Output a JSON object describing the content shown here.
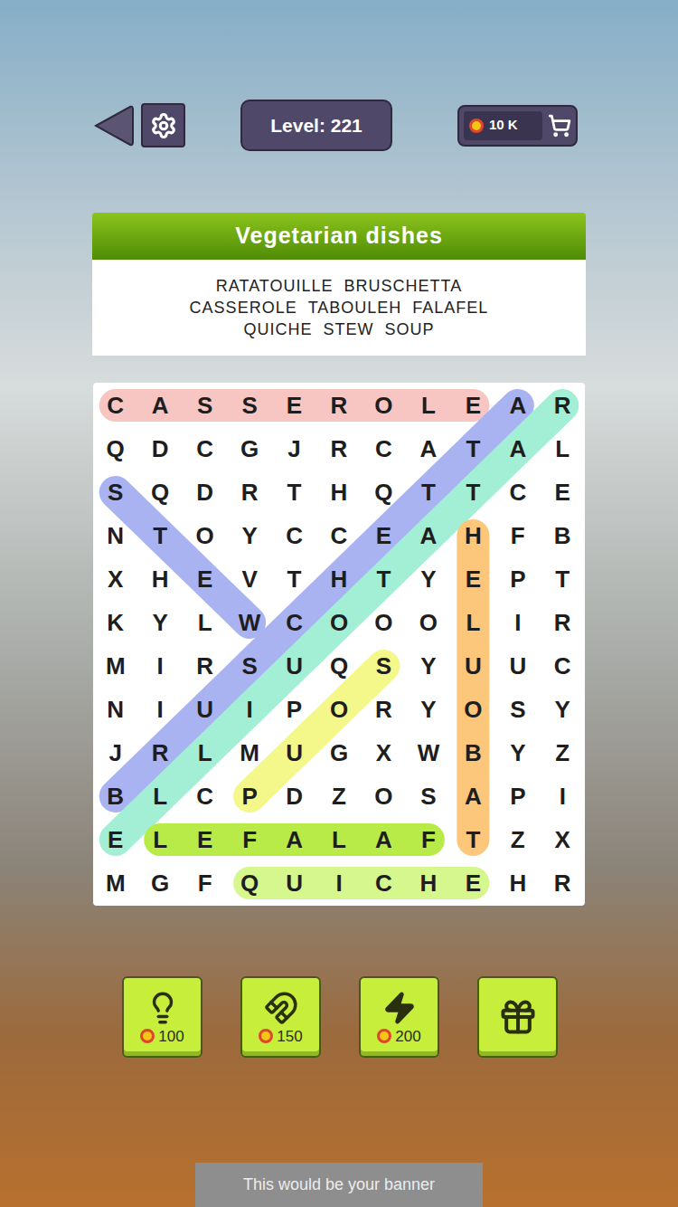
{
  "top_bar": {
    "level": "Level: 221",
    "coins": "10 K"
  },
  "category": {
    "title": "Vegetarian dishes",
    "word_rows": [
      [
        "RATATOUILLE",
        "BRUSCHETTA"
      ],
      [
        "CASSEROLE",
        "TABOULEH",
        "FALAFEL"
      ],
      [
        "QUICHE",
        "STEW",
        "SOUP"
      ]
    ]
  },
  "grid": {
    "rows": [
      [
        "C",
        "A",
        "S",
        "S",
        "E",
        "R",
        "O",
        "L",
        "E",
        "A",
        "R"
      ],
      [
        "Q",
        "D",
        "C",
        "G",
        "J",
        "R",
        "C",
        "A",
        "T",
        "A",
        "L"
      ],
      [
        "S",
        "Q",
        "D",
        "R",
        "T",
        "H",
        "Q",
        "T",
        "T",
        "C",
        "E"
      ],
      [
        "N",
        "T",
        "O",
        "Y",
        "C",
        "C",
        "E",
        "A",
        "H",
        "F",
        "B"
      ],
      [
        "X",
        "H",
        "E",
        "V",
        "T",
        "H",
        "T",
        "Y",
        "E",
        "P",
        "T"
      ],
      [
        "K",
        "Y",
        "L",
        "W",
        "C",
        "O",
        "O",
        "O",
        "L",
        "I",
        "R"
      ],
      [
        "M",
        "I",
        "R",
        "S",
        "U",
        "Q",
        "S",
        "Y",
        "U",
        "U",
        "C"
      ],
      [
        "N",
        "I",
        "U",
        "I",
        "P",
        "O",
        "R",
        "Y",
        "O",
        "S",
        "Y"
      ],
      [
        "J",
        "R",
        "L",
        "M",
        "U",
        "G",
        "X",
        "W",
        "B",
        "Y",
        "Z"
      ],
      [
        "B",
        "L",
        "C",
        "P",
        "D",
        "Z",
        "O",
        "S",
        "A",
        "P",
        "I"
      ],
      [
        "E",
        "L",
        "E",
        "F",
        "A",
        "L",
        "A",
        "F",
        "T",
        "Z",
        "X"
      ],
      [
        "M",
        "G",
        "F",
        "Q",
        "U",
        "I",
        "C",
        "H",
        "E",
        "H",
        "R"
      ]
    ]
  },
  "found": [
    {
      "color": "#f8c6c2",
      "from": {
        "row": 0,
        "col": 0
      },
      "to": {
        "row": 0,
        "col": 8
      }
    },
    {
      "color": "#a9b3f2",
      "from": {
        "row": 2,
        "col": 0
      },
      "to": {
        "row": 5,
        "col": 3
      }
    },
    {
      "color": "#a9b3f2",
      "from": {
        "row": 9,
        "col": 0
      },
      "to": {
        "row": 0,
        "col": 9
      }
    },
    {
      "color": "#a2efd5",
      "from": {
        "row": 0,
        "col": 10
      },
      "to": {
        "row": 10,
        "col": 0
      }
    },
    {
      "color": "#f4f78a",
      "from": {
        "row": 6,
        "col": 6
      },
      "to": {
        "row": 9,
        "col": 3
      }
    },
    {
      "color": "#fcc67b",
      "from": {
        "row": 10,
        "col": 8
      },
      "to": {
        "row": 3,
        "col": 8
      }
    },
    {
      "color": "#b8eb47",
      "from": {
        "row": 10,
        "col": 7
      },
      "to": {
        "row": 10,
        "col": 1
      }
    },
    {
      "color": "#d6f68e",
      "from": {
        "row": 11,
        "col": 3
      },
      "to": {
        "row": 11,
        "col": 8
      }
    }
  ],
  "powerups": [
    {
      "kind": "hint",
      "cost": "100"
    },
    {
      "kind": "magnet",
      "cost": "150"
    },
    {
      "kind": "bolt",
      "cost": "200"
    },
    {
      "kind": "gift"
    }
  ],
  "banner": "This would be your banner"
}
